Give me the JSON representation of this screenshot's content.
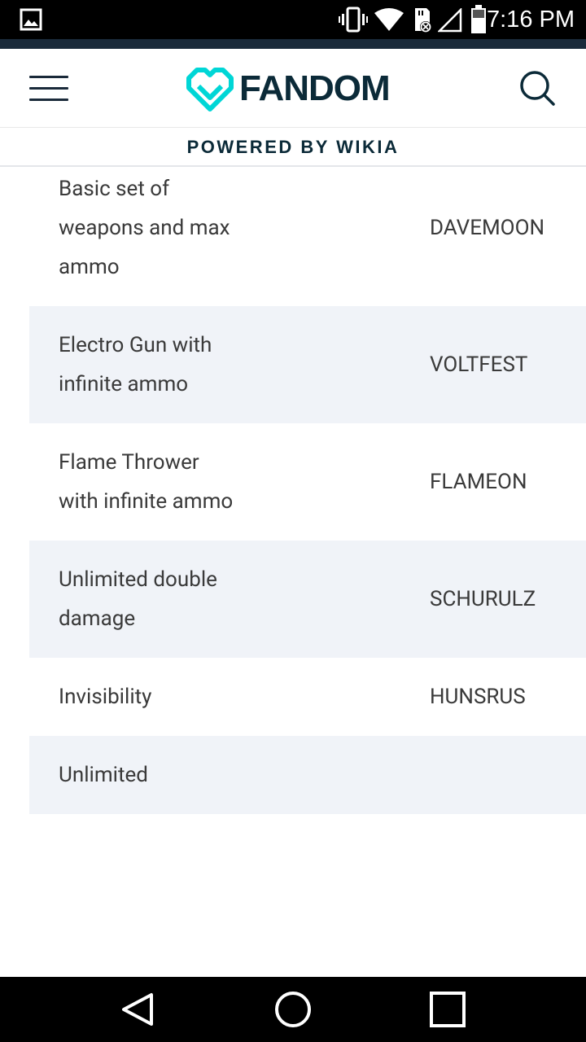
{
  "status_bar": {
    "time": "7:16 PM",
    "icons": [
      "image-icon",
      "vibrate-icon",
      "wifi-icon",
      "sd-card-icon",
      "signal-icon",
      "battery-icon"
    ]
  },
  "header": {
    "logo_text": "FANDOM",
    "powered_by": "POWERED BY WIKIA",
    "brand_color": "#00d6d6",
    "text_color": "#0b2a38"
  },
  "table": {
    "rows": [
      {
        "effect": "Basic set of weapons and max ammo",
        "code": "DAVEMOON",
        "shaded": false
      },
      {
        "effect": "Electro Gun with infinite ammo",
        "code": "VOLTFEST",
        "shaded": true
      },
      {
        "effect": "Flame Thrower with infinite ammo",
        "code": "FLAMEON",
        "shaded": false
      },
      {
        "effect": "Unlimited double damage",
        "code": "SCHURULZ",
        "shaded": true
      },
      {
        "effect": "Invisibility",
        "code": "HUNSRUS",
        "shaded": false
      },
      {
        "effect": "Unlimited",
        "code": "",
        "shaded": true
      }
    ]
  },
  "nav_bar": {
    "buttons": [
      "back-icon",
      "home-icon",
      "recents-icon"
    ]
  }
}
